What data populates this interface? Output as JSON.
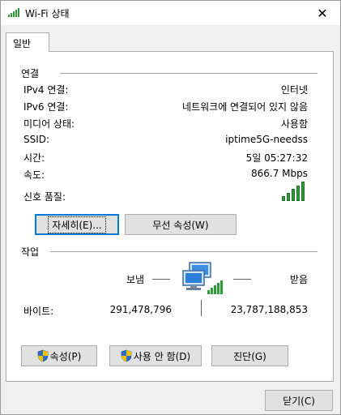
{
  "window": {
    "title": "Wi-Fi 상태",
    "close_glyph": "✕"
  },
  "tab": {
    "label": "일반"
  },
  "connection": {
    "group_title": "연결",
    "rows": [
      {
        "label": "IPv4 연결:",
        "value": "인터넷"
      },
      {
        "label": "IPv6 연결:",
        "value": "네트워크에 연결되어 있지 않음"
      },
      {
        "label": "미디어 상태:",
        "value": "사용함"
      },
      {
        "label": "SSID:",
        "value": "iptime5G-needss"
      },
      {
        "label": "시간:",
        "value": "5일 05:27:32"
      },
      {
        "label": "속도:",
        "value": "866.7 Mbps"
      }
    ],
    "signal_label": "신호 품질:",
    "signal_level": 5,
    "signal_max": 5
  },
  "buttons": {
    "details": "자세히(E)...",
    "wireless_props": "무선 속성(W)",
    "properties": "속성(P)",
    "disable": "사용 안 함(D)",
    "diagnose": "진단(G)",
    "close": "닫기(C)"
  },
  "activity": {
    "group_title": "작업",
    "sent_label": "보냄",
    "received_label": "받음",
    "bytes_label": "바이트:",
    "bytes_sent": "291,478,796",
    "bytes_received": "23,787,188,853"
  },
  "colors": {
    "signal": "#2e9a3a",
    "focus_border": "#0078d7",
    "shield_blue": "#2f6fc9",
    "shield_yellow": "#f2c200"
  },
  "icons": {
    "title": "wifi-signal-icon",
    "network": "network-computers-icon",
    "shield": "uac-shield-icon"
  }
}
